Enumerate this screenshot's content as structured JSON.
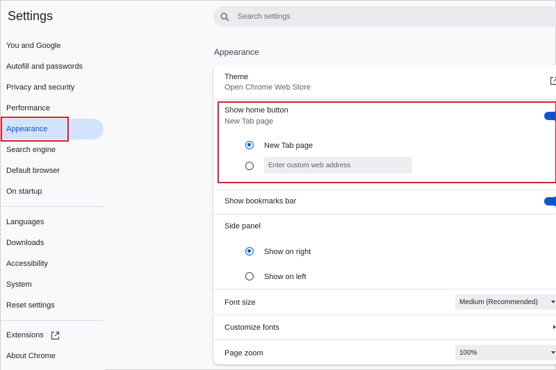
{
  "app": {
    "title": "Settings"
  },
  "sidebar": {
    "items": [
      {
        "label": "You and Google"
      },
      {
        "label": "Autofill and passwords"
      },
      {
        "label": "Privacy and security"
      },
      {
        "label": "Performance"
      },
      {
        "label": "Appearance",
        "active": true
      },
      {
        "label": "Search engine"
      },
      {
        "label": "Default browser"
      },
      {
        "label": "On startup"
      },
      {
        "label": "Languages"
      },
      {
        "label": "Downloads"
      },
      {
        "label": "Accessibility"
      },
      {
        "label": "System"
      },
      {
        "label": "Reset settings"
      },
      {
        "label": "Extensions",
        "icon": "open-in-new-icon"
      },
      {
        "label": "About Chrome"
      }
    ]
  },
  "search": {
    "placeholder": "Search settings",
    "icon": "search-icon"
  },
  "main": {
    "section_title": "Appearance",
    "theme": {
      "label": "Theme",
      "sublabel": "Open Chrome Web Store",
      "icon": "open-in-new-icon"
    },
    "home_button": {
      "label": "Show home button",
      "sublabel": "New Tab page",
      "enabled": true,
      "options": [
        {
          "label": "New Tab page",
          "checked": true
        },
        {
          "placeholder": "Enter custom web address",
          "checked": false
        }
      ]
    },
    "bookmarks_bar": {
      "label": "Show bookmarks bar",
      "enabled": true
    },
    "side_panel": {
      "label": "Side panel",
      "options": [
        {
          "label": "Show on right",
          "checked": true
        },
        {
          "label": "Show on left",
          "checked": false
        }
      ]
    },
    "font_size": {
      "label": "Font size",
      "value": "Medium (Recommended)"
    },
    "customize_fonts": {
      "label": "Customize fonts"
    },
    "page_zoom": {
      "label": "Page zoom",
      "value": "100%"
    }
  },
  "colors": {
    "accent": "#0b57d0",
    "highlight": "#d3202f",
    "active_bg": "#d3e3fd"
  }
}
